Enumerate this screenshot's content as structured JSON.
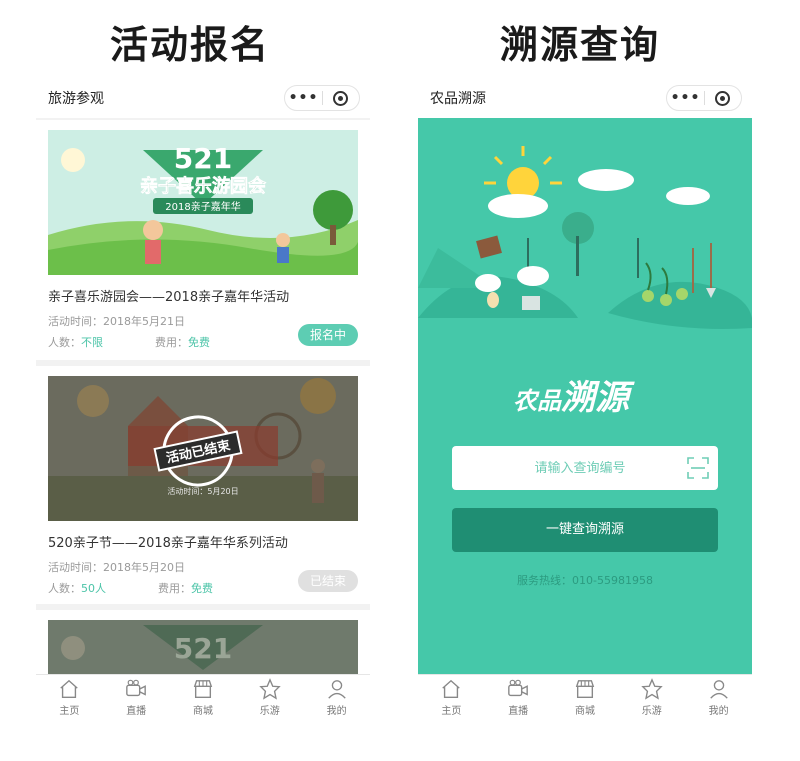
{
  "headings": {
    "left": "活动报名",
    "right": "溯源查询"
  },
  "left_phone": {
    "topbar_title": "旅游参观",
    "capsule": {
      "menu_icon": "•••",
      "close_icon": "target-icon"
    },
    "cards": [
      {
        "banner_text": "521",
        "banner_subtitle": "亲子喜乐游园会",
        "banner_tag": "2018亲子嘉年华",
        "title": "亲子喜乐游园会——2018亲子嘉年华活动",
        "time_label": "活动时间：",
        "time_value": "2018年5月21日",
        "people_label": "人数：",
        "people_value": "不限",
        "fee_label": "费用：",
        "fee_value": "免费",
        "status": "报名中"
      },
      {
        "banner_text": "活动已结束",
        "banner_sub": "活动时间：5月20日",
        "title": "520亲子节——2018亲子嘉年华系列活动",
        "time_label": "活动时间：",
        "time_value": "2018年5月20日",
        "people_label": "人数：",
        "people_value": "50人",
        "fee_label": "费用：",
        "fee_value": "免费",
        "status": "已结束"
      },
      {
        "banner_text": "521"
      }
    ],
    "tabs": [
      "主页",
      "直播",
      "商城",
      "乐游",
      "我的"
    ]
  },
  "right_phone": {
    "topbar_title": "农品溯源",
    "title_small": "农品",
    "title_big": "溯源",
    "search_placeholder": "请输入查询编号",
    "query_button": "一键查询溯源",
    "hotline": "服务热线：010-55981958",
    "tabs": [
      "主页",
      "直播",
      "商城",
      "乐游",
      "我的"
    ]
  },
  "colors": {
    "accent": "#45c8a9",
    "button_dark": "#1f8e73",
    "status_open": "#5dcdb3",
    "status_closed": "#e0e0e0"
  }
}
